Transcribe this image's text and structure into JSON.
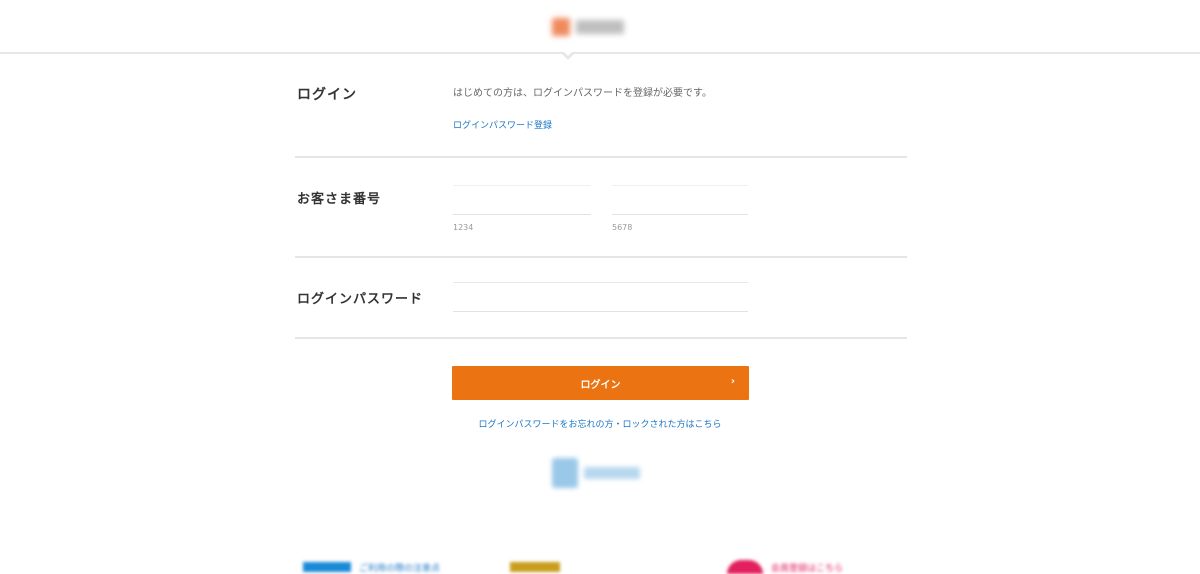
{
  "header": {
    "logo_icon": "brand-logo"
  },
  "login_section": {
    "title": "ログイン",
    "intro_text": "はじめての方は、ログインパスワードを登録が必要です。",
    "register_link": "ログインパスワード登録"
  },
  "customer_number": {
    "label": "お客さま番号",
    "field_a_placeholder": "",
    "field_b_placeholder": "",
    "hint_a": "1234",
    "hint_b": "5678"
  },
  "password": {
    "label": "ログインパスワード",
    "placeholder": ""
  },
  "actions": {
    "login_label": "ログイン",
    "login_chevron": "›",
    "forgot_link": "ログインパスワードをお忘れの方・ロックされた方はこちら"
  },
  "footer": {
    "banners": [
      {
        "label": "ご利用の際の注意点"
      },
      {
        "label": ""
      },
      {
        "label": "会員登録はこちら"
      }
    ]
  },
  "colors": {
    "accent": "#ec7312",
    "link": "#1a76c8",
    "divider": "#e5e5e5"
  }
}
